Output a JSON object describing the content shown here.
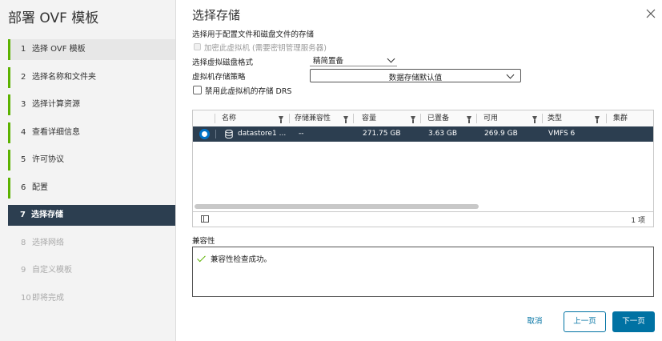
{
  "wizard": {
    "title": "部署 OVF 模板",
    "steps": [
      {
        "num": "1",
        "label": "选择 OVF 模板"
      },
      {
        "num": "2",
        "label": "选择名称和文件夹"
      },
      {
        "num": "3",
        "label": "选择计算资源"
      },
      {
        "num": "4",
        "label": "查看详细信息"
      },
      {
        "num": "5",
        "label": "许可协议"
      },
      {
        "num": "6",
        "label": "配置"
      },
      {
        "num": "7",
        "label": "选择存储"
      },
      {
        "num": "8",
        "label": "选择网络"
      },
      {
        "num": "9",
        "label": "自定义模板"
      },
      {
        "num": "10",
        "label": "即将完成"
      }
    ]
  },
  "main": {
    "title": "选择存储",
    "subtitle": "选择用于配置文件和磁盘文件的存储",
    "encrypt_label": "加密此虚拟机 (需要密钥管理服务器)",
    "disk_format_label": "选择虚拟磁盘格式",
    "disk_format_value": "精简置备",
    "policy_label": "虚拟机存储策略",
    "policy_value": "数据存储默认值",
    "disable_drs_label": "禁用此虚拟机的存储 DRS"
  },
  "table": {
    "columns": [
      "名称",
      "存储兼容性",
      "容量",
      "已置备",
      "可用",
      "类型",
      "集群"
    ],
    "rows": [
      {
        "name": "datastore1 ...",
        "compat": "--",
        "capacity": "271.75 GB",
        "provisioned": "3.63 GB",
        "free": "269.9 GB",
        "type": "VMFS 6",
        "cluster": ""
      }
    ],
    "item_count": "1 项"
  },
  "compatibility": {
    "title": "兼容性",
    "message": "兼容性检查成功。"
  },
  "footer": {
    "cancel_label": "取消",
    "back_label": "上一页",
    "next_label": "下一页"
  },
  "colors": {
    "accent": "#0072a3",
    "active_step_bg": "#2c3e50",
    "done_marker": "#5cb200"
  },
  "icons": [
    "close-icon",
    "filter-icon",
    "radio-selected-icon",
    "datastore-icon",
    "column-toggle-icon",
    "check-icon",
    "chevron-down-icon"
  ]
}
